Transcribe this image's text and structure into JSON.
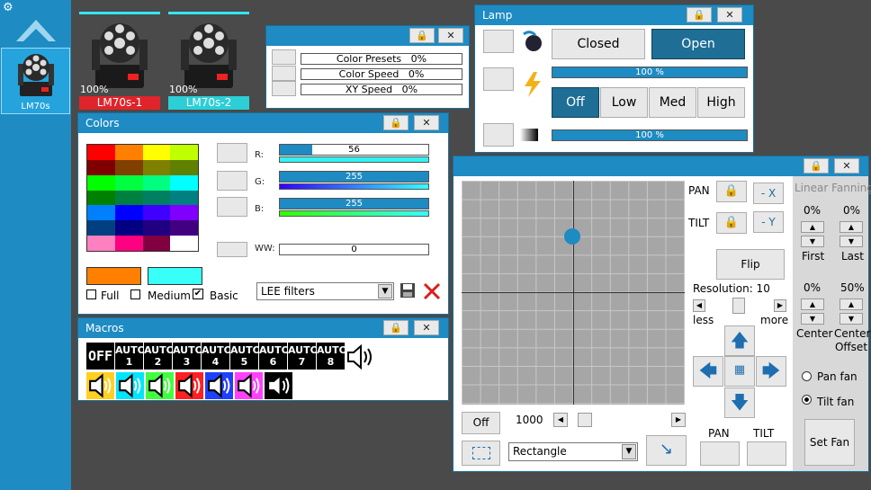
{
  "sidebar": {
    "fixture_label": "LM70s"
  },
  "fixtures": [
    {
      "percent": "100%",
      "name": "LM70s-1",
      "color": "#e0242b"
    },
    {
      "percent": "100%",
      "name": "LM70s-2",
      "color": "#2ccfd6"
    }
  ],
  "presets": {
    "color_presets": "Color Presets",
    "color_presets_val": "0%",
    "color_speed": "Color Speed",
    "color_speed_val": "0%",
    "xy_speed": "XY Speed",
    "xy_speed_val": "0%"
  },
  "lamp": {
    "title": "Lamp",
    "closed": "Closed",
    "open": "Open",
    "bar1": "100 %",
    "off": "Off",
    "low": "Low",
    "med": "Med",
    "high": "High",
    "bar2": "100 %",
    "bar1_level": 1.0,
    "bar2_level": 1.0
  },
  "colors": {
    "title": "Colors",
    "r_label": "R:",
    "r_value": "56",
    "r_level": 0.219,
    "g_label": "G:",
    "g_value": "255",
    "g_level": 1.0,
    "b_label": "B:",
    "b_value": "255",
    "b_level": 1.0,
    "ww_label": "WW:",
    "ww_value": "0",
    "ww_level": 0.0,
    "full": "Full",
    "medium": "Medium",
    "basic": "Basic",
    "filter": "LEE filters",
    "grid": [
      "#ff0000",
      "#ff8000",
      "#ffff00",
      "#c0ff00",
      "#800000",
      "#804000",
      "#808000",
      "#608000",
      "#00ff00",
      "#00ff40",
      "#00ff80",
      "#00ffff",
      "#008000",
      "#008040",
      "#008060",
      "#008080",
      "#0080ff",
      "#0000ff",
      "#4000ff",
      "#8000ff",
      "#004080",
      "#000080",
      "#200080",
      "#400080",
      "#ff80c0",
      "#ff0080",
      "#800040",
      "#ffffff"
    ],
    "swatch_a": "#ff8000",
    "swatch_b": "#38fff8"
  },
  "macros": {
    "title": "Macros",
    "off": "OFF",
    "auto": [
      {
        "a": "AUTO",
        "n": "1"
      },
      {
        "a": "AUTO",
        "n": "2"
      },
      {
        "a": "AUTO",
        "n": "3"
      },
      {
        "a": "AUTO",
        "n": "4"
      },
      {
        "a": "AUTO",
        "n": "5"
      },
      {
        "a": "AUTO",
        "n": "6"
      },
      {
        "a": "AUTO",
        "n": "7"
      },
      {
        "a": "AUTO",
        "n": "8"
      }
    ],
    "sound_colors": [
      "#ffd020",
      "#00e5ff",
      "#40ff40",
      "#ff2020",
      "#2040ff",
      "#ff40ff",
      "#000000"
    ]
  },
  "position": {
    "pan": "PAN",
    "tilt": "TILT",
    "neg_x": "- X",
    "neg_y": "- Y",
    "flip": "Flip",
    "resolution": "Resolution: 10",
    "less": "less",
    "more": "more",
    "off": "Off",
    "speed": "1000",
    "shape": "Rectangle",
    "pan_btn": "PAN",
    "tilt_btn": "TILT",
    "linear_fanning": "Linear Fanning",
    "first_pct": "0%",
    "first": "First",
    "last_pct": "0%",
    "last": "Last",
    "center_pct": "0%",
    "center": "Center",
    "offset_pct": "50%",
    "offset": "Center Offset",
    "pan_fan": "Pan fan",
    "tilt_fan": "Tilt fan",
    "set_fan": "Set Fan"
  }
}
